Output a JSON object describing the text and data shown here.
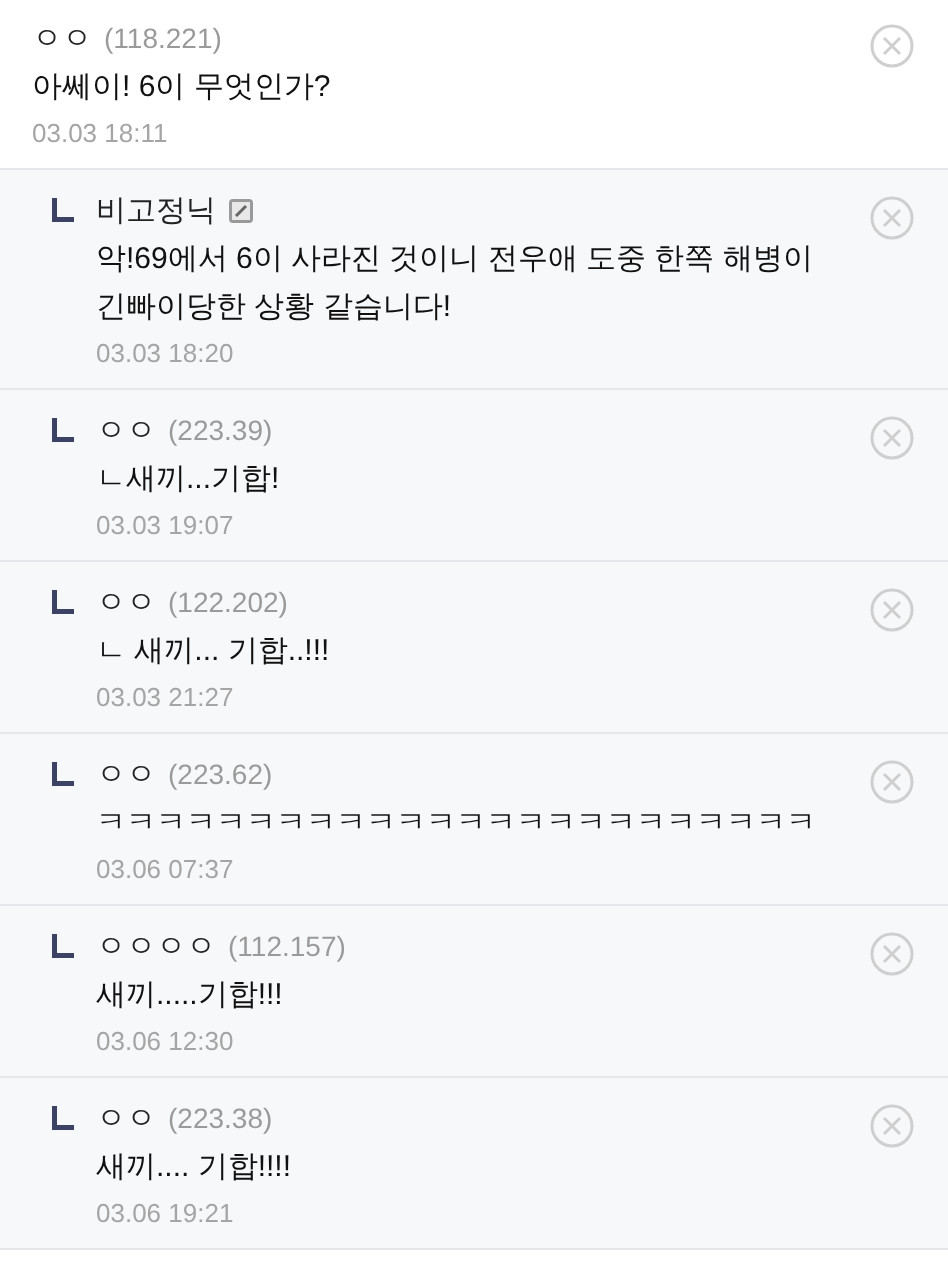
{
  "comments": [
    {
      "kind": "comment",
      "name": "ㅇㅇ",
      "ip": "(118.221)",
      "fixed_nick": false,
      "text": "아쎄이! 6이 무엇인가?",
      "date": "03.03 18:11"
    },
    {
      "kind": "reply",
      "name": "비고정닉",
      "fixed_nick": true,
      "text": "악!69에서 6이 사라진 것이니 전우애 도중 한쪽 해병이 긴빠이당한 상황 같습니다!",
      "date": "03.03 18:20"
    },
    {
      "kind": "reply",
      "name": "ㅇㅇ",
      "ip": "(223.39)",
      "fixed_nick": false,
      "text": "ㄴ새끼...기합!",
      "date": "03.03 19:07"
    },
    {
      "kind": "reply",
      "name": "ㅇㅇ",
      "ip": "(122.202)",
      "fixed_nick": false,
      "text": "ㄴ 새끼... 기합..!!!",
      "date": "03.03 21:27"
    },
    {
      "kind": "reply",
      "name": "ㅇㅇ",
      "ip": "(223.62)",
      "fixed_nick": false,
      "text": "ㅋㅋㅋㅋㅋㅋㅋㅋㅋㅋㅋㅋㅋㅋㅋㅋㅋㅋㅋㅋㅋㅋㅋㅋ",
      "date": "03.06 07:37"
    },
    {
      "kind": "reply",
      "name": "ㅇㅇㅇㅇ",
      "ip": "(112.157)",
      "fixed_nick": false,
      "text": "새끼.....기합!!!",
      "date": "03.06 12:30"
    },
    {
      "kind": "reply",
      "name": "ㅇㅇ",
      "ip": "(223.38)",
      "fixed_nick": false,
      "text": "새끼.... 기합!!!!",
      "date": "03.06 19:21"
    }
  ]
}
